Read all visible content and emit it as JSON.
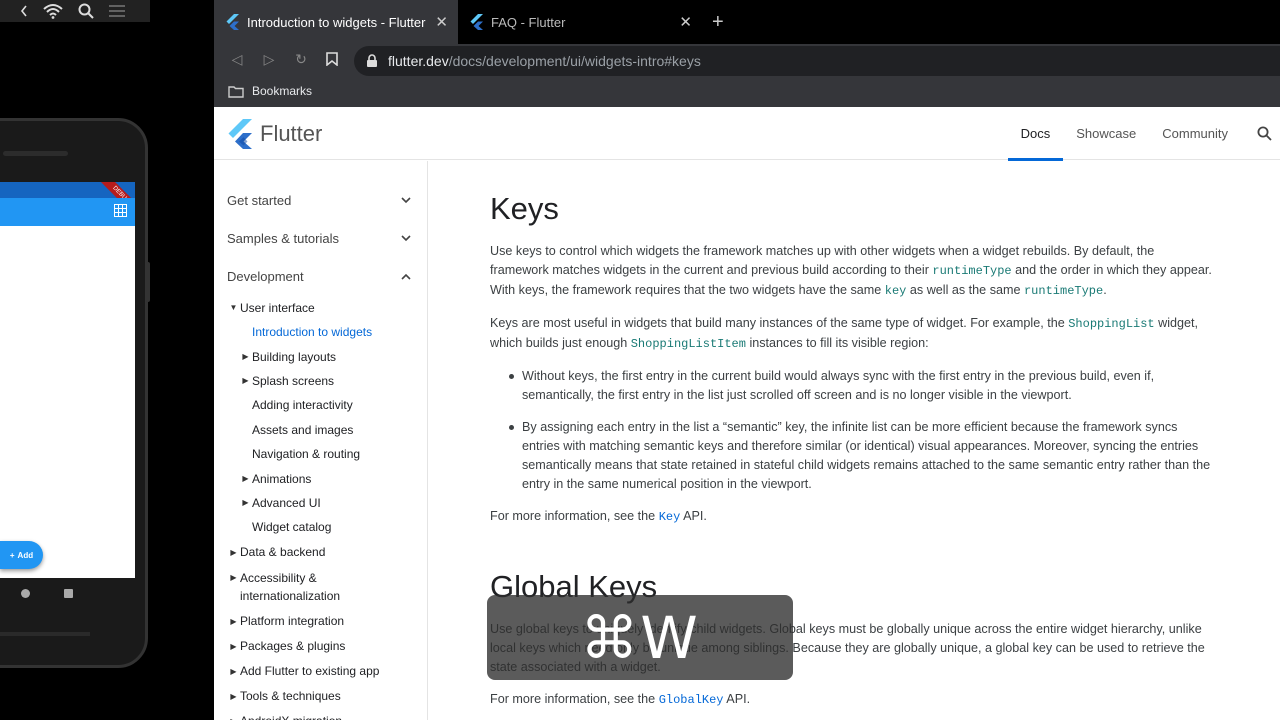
{
  "browser": {
    "tabs": [
      {
        "title": "Introduction to widgets - Flutter",
        "active": true
      },
      {
        "title": "FAQ - Flutter",
        "active": false
      }
    ],
    "url_host": "flutter.dev",
    "url_path": "/docs/development/ui/widgets-intro#keys",
    "bookmarks_label": "Bookmarks"
  },
  "site": {
    "brand": "Flutter",
    "topnav": [
      "Docs",
      "Showcase",
      "Community"
    ]
  },
  "sidebar": {
    "top": [
      "Get started",
      "Samples & tutorials",
      "Development"
    ],
    "ui_section": "User interface",
    "ui_items": [
      {
        "label": "Introduction to widgets",
        "caret": false,
        "active": true
      },
      {
        "label": "Building layouts",
        "caret": true
      },
      {
        "label": "Splash screens",
        "caret": true
      },
      {
        "label": "Adding interactivity",
        "caret": false
      },
      {
        "label": "Assets and images",
        "caret": false
      },
      {
        "label": "Navigation & routing",
        "caret": false
      },
      {
        "label": "Animations",
        "caret": true
      },
      {
        "label": "Advanced UI",
        "caret": true
      },
      {
        "label": "Widget catalog",
        "caret": false
      }
    ],
    "dev_items": [
      "Data & backend",
      "Accessibility & internationalization",
      "Platform integration",
      "Packages & plugins",
      "Add Flutter to existing app",
      "Tools & techniques",
      "AndroidX migration"
    ]
  },
  "article": {
    "h1": "Keys",
    "p1": {
      "t1": "Use keys to control which widgets the framework matches up with other widgets when a widget rebuilds. By default, the framework matches widgets in the current and previous build according to their ",
      "c1": "runtimeType",
      "t2": " and the order in which they appear. With keys, the framework requires that the two widgets have the same ",
      "c2": "key",
      "t3": " as well as the same ",
      "c3": "runtimeType",
      "t4": "."
    },
    "p2": {
      "t1": "Keys are most useful in widgets that build many instances of the same type of widget. For example, the ",
      "c1": "ShoppingList",
      "t2": " widget, which builds just enough ",
      "c2": "ShoppingListItem",
      "t3": " instances to fill its visible region:"
    },
    "bullets": [
      "Without keys, the first entry in the current build would always sync with the first entry in the previous build, even if, semantically, the first entry in the list just scrolled off screen and is no longer visible in the viewport.",
      "By assigning each entry in the list a “semantic” key, the infinite list can be more efficient because the framework syncs entries with matching semantic keys and therefore similar (or identical) visual appearances. Moreover, syncing the entries semantically means that state retained in stateful child widgets remains attached to the same semantic entry rather than the entry in the same numerical position in the viewport."
    ],
    "p3": {
      "t1": "For more information, see the ",
      "c1": "Key",
      "t2": " API."
    },
    "h2": "Global Keys",
    "p4": "Use global keys to uniquely identify child widgets. Global keys must be globally unique across the entire widget hierarchy, unlike local keys which need only be unique among siblings. Because they are globally unique, a global key can be used to retrieve the state associated with a widget.",
    "p5": {
      "t1": "For more information, see the ",
      "c1": "GlobalKey",
      "t2": " API."
    }
  },
  "phone": {
    "fab_label": "Add",
    "ribbon": "DEBUG"
  },
  "keycast": "⌘W",
  "colors": {
    "accent": "#0468d7",
    "code": "#1a7a75",
    "app_bar": "#2196f3"
  }
}
